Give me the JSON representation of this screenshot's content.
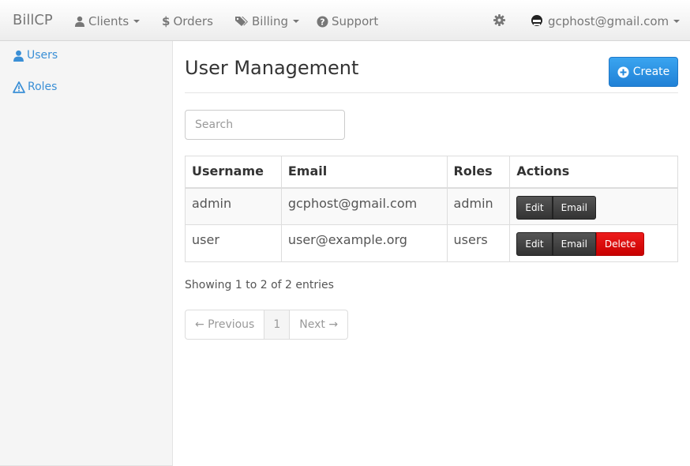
{
  "navbar": {
    "brand": "BillCP",
    "clients": "Clients",
    "orders": "Orders",
    "billing": "Billing",
    "support": "Support",
    "user_email": "gcphost@gmail.com"
  },
  "sidebar": {
    "items": [
      {
        "label": "Users",
        "icon": "user-icon"
      },
      {
        "label": "Roles",
        "icon": "warning-icon"
      }
    ]
  },
  "main": {
    "title": "User Management",
    "create_label": "Create",
    "search_placeholder": "Search",
    "table": {
      "headers": [
        "Username",
        "Email",
        "Roles",
        "Actions"
      ],
      "rows": [
        {
          "username": "admin",
          "email": "gcphost@gmail.com",
          "roles": "admin",
          "actions": [
            "Edit",
            "Email"
          ]
        },
        {
          "username": "user",
          "email": "user@example.org",
          "roles": "users",
          "actions": [
            "Edit",
            "Email",
            "Delete"
          ]
        }
      ]
    },
    "showing": "Showing 1 to 2 of 2 entries",
    "pagination": {
      "previous": "← Previous",
      "page": "1",
      "next": "Next →"
    }
  },
  "colors": {
    "accent": "#2d8fe0",
    "link": "#3a8fd6",
    "danger": "#d40000",
    "dark_button": "#444444"
  }
}
